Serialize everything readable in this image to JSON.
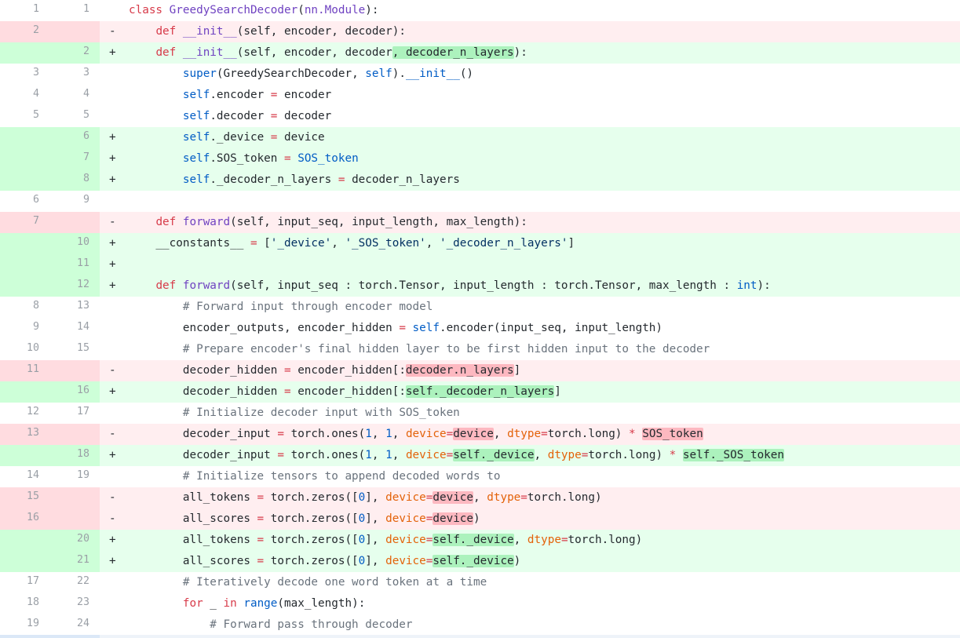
{
  "diff": {
    "rows": [
      {
        "type": "ctx",
        "old": "1",
        "new": "1",
        "marker": "",
        "tokens": [
          [
            "kw",
            "class "
          ],
          [
            "fn",
            "GreedySearchDecoder"
          ],
          [
            "",
            "("
          ],
          [
            "fn",
            "nn.Module"
          ],
          [
            "",
            "):"
          ]
        ]
      },
      {
        "type": "del",
        "old": "2",
        "new": "",
        "marker": "-",
        "tokens": [
          [
            "",
            "    "
          ],
          [
            "kw",
            "def "
          ],
          [
            "fn",
            "__init__"
          ],
          [
            "",
            "(self, encoder, decoder):"
          ]
        ]
      },
      {
        "type": "add",
        "old": "",
        "new": "2",
        "marker": "+",
        "tokens": [
          [
            "",
            "    "
          ],
          [
            "kw",
            "def "
          ],
          [
            "fn",
            "__init__"
          ],
          [
            "",
            "(self, encoder, decoder"
          ],
          [
            "x-add",
            ", decoder_n_layers"
          ],
          [
            "",
            "):"
          ]
        ]
      },
      {
        "type": "ctx",
        "old": "3",
        "new": "3",
        "marker": "",
        "tokens": [
          [
            "",
            "        "
          ],
          [
            "bi",
            "super"
          ],
          [
            "",
            "(GreedySearchDecoder, "
          ],
          [
            "bi",
            "self"
          ],
          [
            "",
            ")."
          ],
          [
            "bi",
            "__init__"
          ],
          [
            "",
            "()"
          ]
        ]
      },
      {
        "type": "ctx",
        "old": "4",
        "new": "4",
        "marker": "",
        "tokens": [
          [
            "",
            "        "
          ],
          [
            "bi",
            "self"
          ],
          [
            "",
            ".encoder "
          ],
          [
            "kw",
            "="
          ],
          [
            "",
            " encoder"
          ]
        ]
      },
      {
        "type": "ctx",
        "old": "5",
        "new": "5",
        "marker": "",
        "tokens": [
          [
            "",
            "        "
          ],
          [
            "bi",
            "self"
          ],
          [
            "",
            ".decoder "
          ],
          [
            "kw",
            "="
          ],
          [
            "",
            " decoder"
          ]
        ]
      },
      {
        "type": "add",
        "old": "",
        "new": "6",
        "marker": "+",
        "tokens": [
          [
            "",
            "        "
          ],
          [
            "bi",
            "self"
          ],
          [
            "",
            "._device "
          ],
          [
            "kw",
            "="
          ],
          [
            "",
            " device"
          ]
        ]
      },
      {
        "type": "add",
        "old": "",
        "new": "7",
        "marker": "+",
        "tokens": [
          [
            "",
            "        "
          ],
          [
            "bi",
            "self"
          ],
          [
            "",
            ".SOS_token "
          ],
          [
            "kw",
            "="
          ],
          [
            "",
            " "
          ],
          [
            "bi",
            "SOS_token"
          ]
        ]
      },
      {
        "type": "add",
        "old": "",
        "new": "8",
        "marker": "+",
        "tokens": [
          [
            "",
            "        "
          ],
          [
            "bi",
            "self"
          ],
          [
            "",
            "._decoder_n_layers "
          ],
          [
            "kw",
            "="
          ],
          [
            "",
            " decoder_n_layers"
          ]
        ]
      },
      {
        "type": "ctx",
        "old": "6",
        "new": "9",
        "marker": "",
        "tokens": []
      },
      {
        "type": "del",
        "old": "7",
        "new": "",
        "marker": "-",
        "tokens": [
          [
            "",
            "    "
          ],
          [
            "kw",
            "def "
          ],
          [
            "fn",
            "forward"
          ],
          [
            "",
            "(self, input_seq, input_length, max_length):"
          ]
        ]
      },
      {
        "type": "add",
        "old": "",
        "new": "10",
        "marker": "+",
        "tokens": [
          [
            "",
            "    __constants__ "
          ],
          [
            "kw",
            "="
          ],
          [
            "",
            " ["
          ],
          [
            "str",
            "'_device'"
          ],
          [
            "",
            ", "
          ],
          [
            "str",
            "'_SOS_token'"
          ],
          [
            "",
            ", "
          ],
          [
            "str",
            "'_decoder_n_layers'"
          ],
          [
            "",
            "]"
          ]
        ]
      },
      {
        "type": "add",
        "old": "",
        "new": "11",
        "marker": "+",
        "tokens": []
      },
      {
        "type": "add",
        "old": "",
        "new": "12",
        "marker": "+",
        "tokens": [
          [
            "",
            "    "
          ],
          [
            "kw",
            "def "
          ],
          [
            "fn",
            "forward"
          ],
          [
            "",
            "(self, input_seq : torch.Tensor, input_length : torch.Tensor, max_length : "
          ],
          [
            "bi",
            "int"
          ],
          [
            "",
            "):"
          ]
        ]
      },
      {
        "type": "ctx",
        "old": "8",
        "new": "13",
        "marker": "",
        "tokens": [
          [
            "",
            "        "
          ],
          [
            "cmt",
            "# Forward input through encoder model"
          ]
        ]
      },
      {
        "type": "ctx",
        "old": "9",
        "new": "14",
        "marker": "",
        "tokens": [
          [
            "",
            "        encoder_outputs, encoder_hidden "
          ],
          [
            "kw",
            "="
          ],
          [
            "",
            " "
          ],
          [
            "bi",
            "self"
          ],
          [
            "",
            ".encoder(input_seq, input_length)"
          ]
        ]
      },
      {
        "type": "ctx",
        "old": "10",
        "new": "15",
        "marker": "",
        "tokens": [
          [
            "",
            "        "
          ],
          [
            "cmt",
            "# Prepare encoder's final hidden layer to be first hidden input to the decoder"
          ]
        ]
      },
      {
        "type": "del",
        "old": "11",
        "new": "",
        "marker": "-",
        "tokens": [
          [
            "",
            "        decoder_hidden "
          ],
          [
            "kw",
            "="
          ],
          [
            "",
            " encoder_hidden[:"
          ],
          [
            "x-del",
            "decoder.n_layers"
          ],
          [
            "",
            "]"
          ]
        ]
      },
      {
        "type": "add",
        "old": "",
        "new": "16",
        "marker": "+",
        "tokens": [
          [
            "",
            "        decoder_hidden "
          ],
          [
            "kw",
            "="
          ],
          [
            "",
            " encoder_hidden[:"
          ],
          [
            "x-add",
            "self._decoder_n_layers"
          ],
          [
            "",
            "]"
          ]
        ]
      },
      {
        "type": "ctx",
        "old": "12",
        "new": "17",
        "marker": "",
        "tokens": [
          [
            "",
            "        "
          ],
          [
            "cmt",
            "# Initialize decoder input with SOS_token"
          ]
        ]
      },
      {
        "type": "del",
        "old": "13",
        "new": "",
        "marker": "-",
        "tokens": [
          [
            "",
            "        decoder_input "
          ],
          [
            "kw",
            "="
          ],
          [
            "",
            " torch.ones("
          ],
          [
            "num-lit",
            "1"
          ],
          [
            "",
            ", "
          ],
          [
            "num-lit",
            "1"
          ],
          [
            "",
            ", "
          ],
          [
            "kwarg",
            "device"
          ],
          [
            "kw",
            "="
          ],
          [
            "x-del",
            "device"
          ],
          [
            "",
            ", "
          ],
          [
            "kwarg",
            "dtype"
          ],
          [
            "kw",
            "="
          ],
          [
            "",
            "torch.long) "
          ],
          [
            "kw",
            "*"
          ],
          [
            "",
            " "
          ],
          [
            "x-del",
            "SOS_token"
          ]
        ]
      },
      {
        "type": "add",
        "old": "",
        "new": "18",
        "marker": "+",
        "tokens": [
          [
            "",
            "        decoder_input "
          ],
          [
            "kw",
            "="
          ],
          [
            "",
            " torch.ones("
          ],
          [
            "num-lit",
            "1"
          ],
          [
            "",
            ", "
          ],
          [
            "num-lit",
            "1"
          ],
          [
            "",
            ", "
          ],
          [
            "kwarg",
            "device"
          ],
          [
            "kw",
            "="
          ],
          [
            "x-add",
            "self._device"
          ],
          [
            "",
            ", "
          ],
          [
            "kwarg",
            "dtype"
          ],
          [
            "kw",
            "="
          ],
          [
            "",
            "torch.long) "
          ],
          [
            "kw",
            "*"
          ],
          [
            "",
            " "
          ],
          [
            "x-add",
            "self._SOS_token"
          ]
        ]
      },
      {
        "type": "ctx",
        "old": "14",
        "new": "19",
        "marker": "",
        "tokens": [
          [
            "",
            "        "
          ],
          [
            "cmt",
            "# Initialize tensors to append decoded words to"
          ]
        ]
      },
      {
        "type": "del",
        "old": "15",
        "new": "",
        "marker": "-",
        "tokens": [
          [
            "",
            "        all_tokens "
          ],
          [
            "kw",
            "="
          ],
          [
            "",
            " torch.zeros(["
          ],
          [
            "num-lit",
            "0"
          ],
          [
            "",
            "], "
          ],
          [
            "kwarg",
            "device"
          ],
          [
            "kw",
            "="
          ],
          [
            "x-del",
            "device"
          ],
          [
            "",
            ", "
          ],
          [
            "kwarg",
            "dtype"
          ],
          [
            "kw",
            "="
          ],
          [
            "",
            "torch.long)"
          ]
        ]
      },
      {
        "type": "del",
        "old": "16",
        "new": "",
        "marker": "-",
        "tokens": [
          [
            "",
            "        all_scores "
          ],
          [
            "kw",
            "="
          ],
          [
            "",
            " torch.zeros(["
          ],
          [
            "num-lit",
            "0"
          ],
          [
            "",
            "], "
          ],
          [
            "kwarg",
            "device"
          ],
          [
            "kw",
            "="
          ],
          [
            "x-del",
            "device"
          ],
          [
            "",
            ")"
          ]
        ]
      },
      {
        "type": "add",
        "old": "",
        "new": "20",
        "marker": "+",
        "tokens": [
          [
            "",
            "        all_tokens "
          ],
          [
            "kw",
            "="
          ],
          [
            "",
            " torch.zeros(["
          ],
          [
            "num-lit",
            "0"
          ],
          [
            "",
            "], "
          ],
          [
            "kwarg",
            "device"
          ],
          [
            "kw",
            "="
          ],
          [
            "x-add",
            "self._device"
          ],
          [
            "",
            ", "
          ],
          [
            "kwarg",
            "dtype"
          ],
          [
            "kw",
            "="
          ],
          [
            "",
            "torch.long)"
          ]
        ]
      },
      {
        "type": "add",
        "old": "",
        "new": "21",
        "marker": "+",
        "tokens": [
          [
            "",
            "        all_scores "
          ],
          [
            "kw",
            "="
          ],
          [
            "",
            " torch.zeros(["
          ],
          [
            "num-lit",
            "0"
          ],
          [
            "",
            "], "
          ],
          [
            "kwarg",
            "device"
          ],
          [
            "kw",
            "="
          ],
          [
            "x-add",
            "self._device"
          ],
          [
            "",
            ")"
          ]
        ]
      },
      {
        "type": "ctx",
        "old": "17",
        "new": "22",
        "marker": "",
        "tokens": [
          [
            "",
            "        "
          ],
          [
            "cmt",
            "# Iteratively decode one word token at a time"
          ]
        ]
      },
      {
        "type": "ctx",
        "old": "18",
        "new": "23",
        "marker": "",
        "tokens": [
          [
            "",
            "        "
          ],
          [
            "kw",
            "for"
          ],
          [
            "",
            " _ "
          ],
          [
            "kw",
            "in"
          ],
          [
            "",
            " "
          ],
          [
            "bi",
            "range"
          ],
          [
            "",
            "(max_length):"
          ]
        ]
      },
      {
        "type": "ctx",
        "old": "19",
        "new": "24",
        "marker": "",
        "tokens": [
          [
            "",
            "            "
          ],
          [
            "cmt",
            "# Forward pass through decoder"
          ]
        ]
      }
    ]
  }
}
